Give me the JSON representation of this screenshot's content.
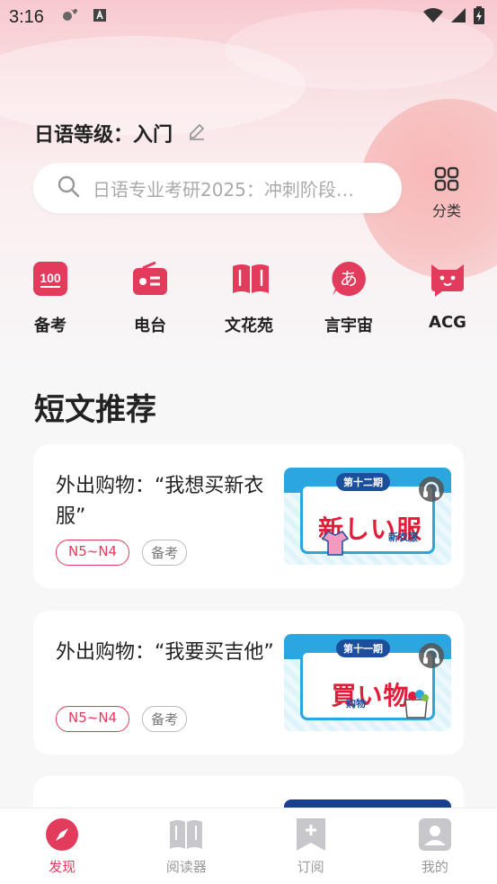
{
  "status_bar": {
    "time": "3:16"
  },
  "header": {
    "level_text": "日语等级：入门",
    "search_placeholder": "日语专业考研2025：冲刺阶段…",
    "category_label": "分类"
  },
  "quick_links": [
    {
      "label": "备考",
      "icon": "exam-100-icon"
    },
    {
      "label": "电台",
      "icon": "radio-icon"
    },
    {
      "label": "文花苑",
      "icon": "book-icon"
    },
    {
      "label": "言宇宙",
      "icon": "hiragana-a-icon"
    },
    {
      "label": "ACG",
      "icon": "cat-icon"
    }
  ],
  "quick_link_icon_text": {
    "exam": "100",
    "hiragana": "あ"
  },
  "section": {
    "title": "短文推荐"
  },
  "articles": [
    {
      "title": "外出购物：“我想买新衣服”",
      "level": "N5~N4",
      "type": "备考",
      "thumb_issue": "第十二期",
      "thumb_main": "新しい服",
      "thumb_sub": "新衣服"
    },
    {
      "title": "外出购物：“我要买吉他”",
      "level": "N5~N4",
      "type": "备考",
      "thumb_issue": "第十一期",
      "thumb_main": "買い物",
      "thumb_sub": "购物"
    }
  ],
  "bottom_nav": [
    {
      "label": "发现",
      "icon": "compass-icon",
      "active": true
    },
    {
      "label": "阅读器",
      "icon": "reader-book-icon",
      "active": false
    },
    {
      "label": "订阅",
      "icon": "subscribe-bookmark-icon",
      "active": false
    },
    {
      "label": "我的",
      "icon": "profile-icon",
      "active": false
    }
  ],
  "colors": {
    "accent": "#e23b5b",
    "thumb_blue": "#2ba6de",
    "thumb_red": "#e21d3a"
  }
}
